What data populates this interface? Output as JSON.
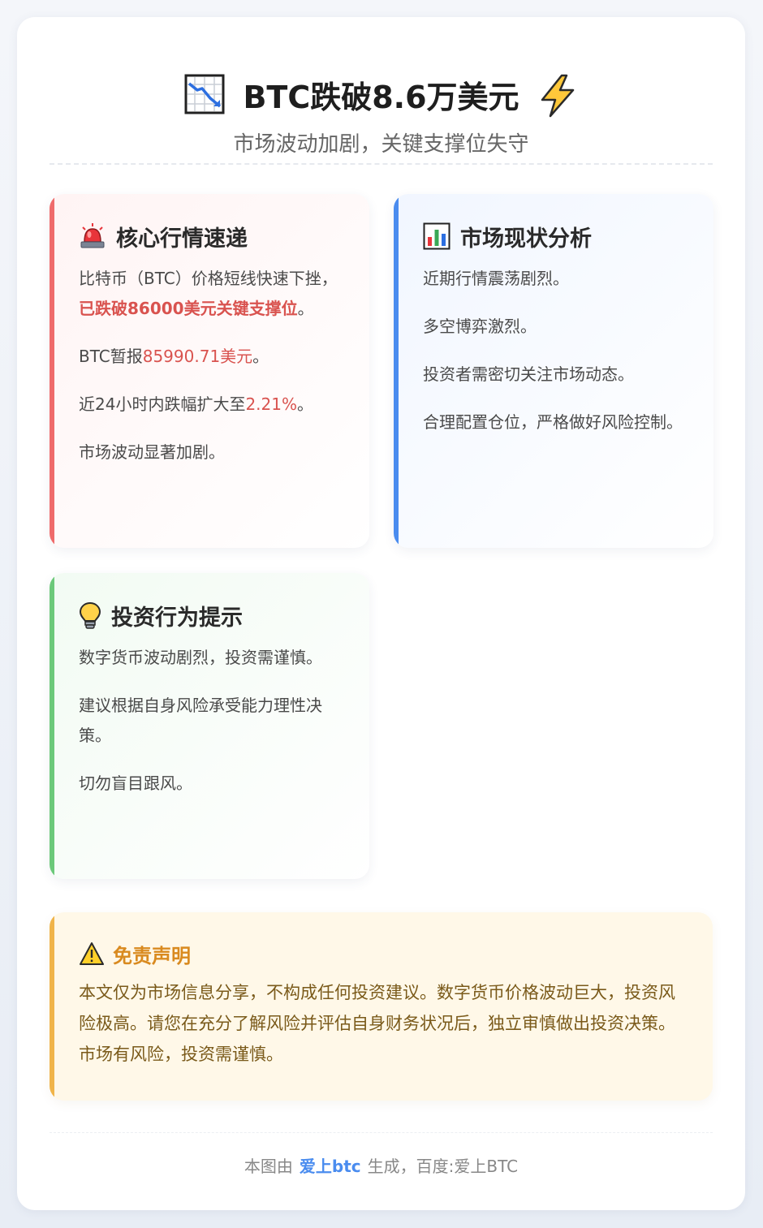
{
  "header": {
    "title": "BTC跌破8.6万美元",
    "subtitle": "市场波动加剧，关键支撑位失守",
    "left_icon": "chart-decreasing-icon",
    "right_icon": "lightning-icon"
  },
  "cards": {
    "core": {
      "icon": "siren-icon",
      "title": "核心行情速递",
      "p1_pre": "比特币（BTC）价格短线快速下挫，",
      "p1_hl": "已跌破86000美元关键支撑位",
      "p1_post": "。",
      "p2_pre": "BTC暂报",
      "p2_hl": "85990.71美元",
      "p2_post": "。",
      "p3_pre": "近24小时内跌幅扩大至",
      "p3_hl": "2.21%",
      "p3_post": "。",
      "p4": "市场波动显著加剧。"
    },
    "market": {
      "icon": "bar-chart-icon",
      "title": "市场现状分析",
      "p1": "近期行情震荡剧烈。",
      "p2": "多空博弈激烈。",
      "p3": "投资者需密切关注市场动态。",
      "p4": "合理配置仓位，严格做好风险控制。"
    },
    "advice": {
      "icon": "lightbulb-icon",
      "title": "投资行为提示",
      "p1": "数字货币波动剧烈，投资需谨慎。",
      "p2": "建议根据自身风险承受能力理性决策。",
      "p3": "切勿盲目跟风。"
    }
  },
  "disclaimer": {
    "icon": "warning-icon",
    "title": "免责声明",
    "text": "本文仅为市场信息分享，不构成任何投资建议。数字货币价格波动巨大，投资风险极高。请您在充分了解风险并评估自身财务状况后，独立审慎做出投资决策。市场有风险，投资需谨慎。"
  },
  "footer": {
    "pre": "本图由",
    "brand": "爱上btc",
    "post": "生成，百度:爱上BTC"
  },
  "colors": {
    "highlight": "#d9534f",
    "red_bar": "#ef6b6b",
    "blue_bar": "#4a8cef",
    "green_bar": "#6cc97a",
    "orange_bar": "#f0b44a",
    "brand": "#4a8cef"
  }
}
